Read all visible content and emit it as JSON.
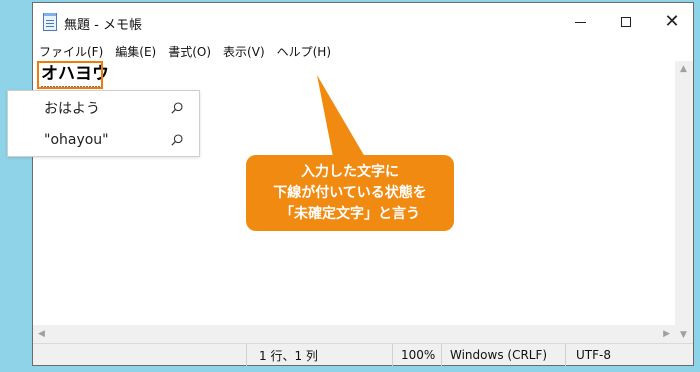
{
  "window": {
    "title": "無題 - メモ帳",
    "controls": {
      "minimize_icon": "minimize-icon",
      "maximize_icon": "maximize-icon",
      "close_icon": "close-icon"
    }
  },
  "menu": {
    "items": [
      "ファイル(F)",
      "編集(E)",
      "書式(O)",
      "表示(V)",
      "ヘルプ(H)"
    ]
  },
  "editor": {
    "composing_text": "オハヨウ"
  },
  "suggestions": {
    "items": [
      {
        "label": "おはよう",
        "icon": "search-icon"
      },
      {
        "label": "\"ohayou\"",
        "icon": "search-icon"
      }
    ]
  },
  "callout": {
    "lines": [
      "入力した文字に",
      "下線が付いている状態を",
      "「未確定文字」と言う"
    ],
    "color": "#f08a10"
  },
  "highlight_color": "#f07a0a",
  "status": {
    "position": "1 行、1 列",
    "zoom": "100%",
    "line_ending": "Windows (CRLF)",
    "encoding": "UTF-8"
  }
}
